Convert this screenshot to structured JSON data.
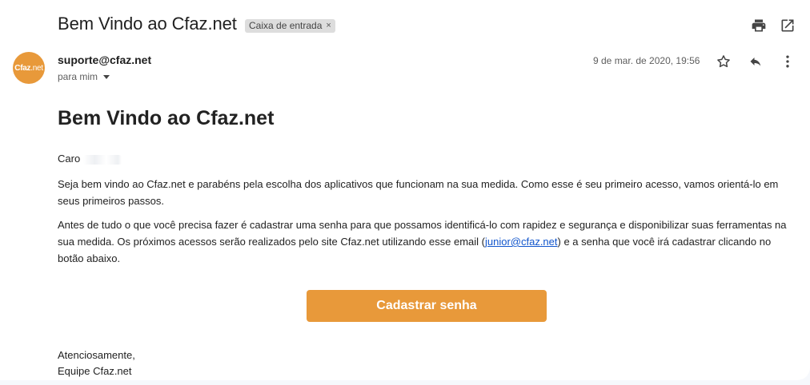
{
  "email": {
    "subject": "Bem Vindo ao Cfaz.net",
    "label": "Caixa de entrada",
    "label_remove": "×",
    "sender_email": "suporte@cfaz.net",
    "recipient": "para mim",
    "date": "9 de mar. de 2020, 19:56",
    "avatar": {
      "bold": "Cfaz",
      "thin": ".net"
    }
  },
  "content": {
    "heading": "Bem Vindo ao Cfaz.net",
    "greeting": "Caro",
    "para1": "Seja bem vindo ao Cfaz.net e parabéns pela escolha dos aplicativos que funcionam na sua medida. Como esse é seu primeiro acesso, vamos orientá-lo em seus primeiros passos.",
    "para2_before": "Antes de tudo o que você precisa fazer é cadastrar uma senha para que possamos identificá-lo com rapidez e segurança e disponibilizar suas ferramentas na sua medida. Os próximos acessos serão realizados pelo site Cfaz.net utilizando esse email (",
    "para2_link": "junior@cfaz.net",
    "para2_after": ") e a senha que você irá cadastrar clicando no botão abaixo.",
    "cta": "Cadastrar senha",
    "closing": "Atenciosamente,",
    "signature": "Equipe Cfaz.net"
  },
  "icons": [
    "print-icon",
    "open-in-new-window-icon",
    "star-icon",
    "reply-icon",
    "more-options-icon",
    "dropdown-caret-icon"
  ],
  "colors": {
    "brand": "#e8993a",
    "link": "#1155cc"
  }
}
